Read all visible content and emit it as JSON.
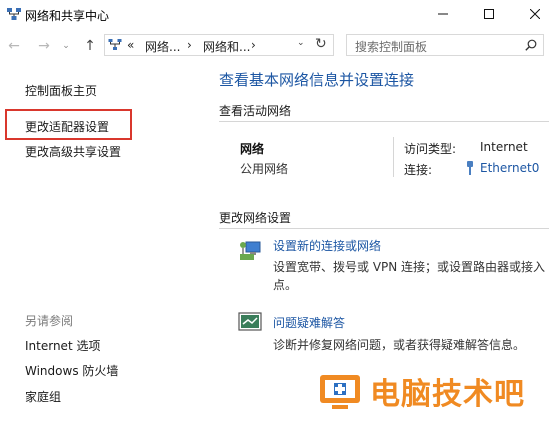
{
  "window": {
    "title": "网络和共享中心",
    "controls": {
      "minimize": "—",
      "maximize": "☐",
      "close": "✕"
    }
  },
  "nav": {
    "back": "←",
    "forward": "→",
    "recent": "⌄",
    "up": "↑",
    "address": {
      "more": "«",
      "crumbs": [
        "网络...",
        "网络和..."
      ],
      "separator": "›",
      "dropdown": "⌄",
      "refresh": "↻"
    },
    "search": {
      "placeholder": "搜索控制面板"
    }
  },
  "left_pane": {
    "links": [
      "控制面板主页",
      "更改适配器设置",
      "更改高级共享设置"
    ],
    "highlighted": "更改适配器设置",
    "see_also": {
      "heading": "另请参阅",
      "links": [
        "Internet 选项",
        "Windows 防火墙",
        "家庭组"
      ]
    }
  },
  "main": {
    "heading": "查看基本网络信息并设置连接",
    "active_networks": {
      "heading": "查看活动网络",
      "network_name": "网络",
      "network_type": "公用网络",
      "access_type_label": "访问类型:",
      "access_type_value": "Internet",
      "connections_label": "连接:",
      "connections_value": "Ethernet0"
    },
    "change_settings": {
      "heading": "更改网络设置",
      "items": [
        {
          "icon": "new-connection-icon",
          "link": "设置新的连接或网络",
          "desc": "设置宽带、拨号或 VPN 连接；或设置路由器或接入点。"
        },
        {
          "icon": "troubleshoot-icon",
          "link": "问题疑难解答",
          "desc": "诊断并修复网络问题，或者获得疑难解答信息。"
        }
      ]
    }
  },
  "watermark": {
    "text": "电脑技术吧"
  },
  "colors": {
    "link": "#1c56a3",
    "highlight_border": "#d9372d",
    "watermark": "#f08a22"
  }
}
